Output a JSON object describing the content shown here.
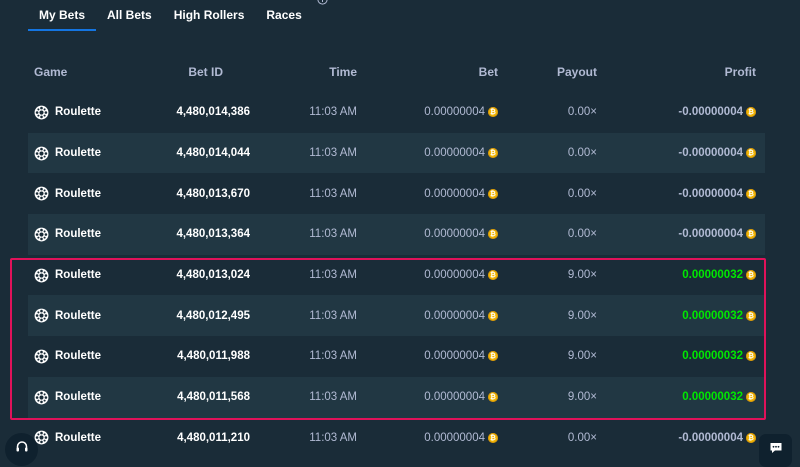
{
  "tabs": [
    {
      "label": "My Bets",
      "active": true
    },
    {
      "label": "All Bets",
      "active": false
    },
    {
      "label": "High Rollers",
      "active": false
    },
    {
      "label": "Races",
      "active": false
    }
  ],
  "columns": {
    "game": "Game",
    "bet_id": "Bet ID",
    "time": "Time",
    "bet": "Bet",
    "payout": "Payout",
    "profit": "Profit"
  },
  "rows": [
    {
      "game": "Roulette",
      "bet_id": "4,480,014,386",
      "time": "11:03 AM",
      "bet": "0.00000004",
      "payout": "0.00×",
      "profit": "-0.00000004",
      "win": false
    },
    {
      "game": "Roulette",
      "bet_id": "4,480,014,044",
      "time": "11:03 AM",
      "bet": "0.00000004",
      "payout": "0.00×",
      "profit": "-0.00000004",
      "win": false
    },
    {
      "game": "Roulette",
      "bet_id": "4,480,013,670",
      "time": "11:03 AM",
      "bet": "0.00000004",
      "payout": "0.00×",
      "profit": "-0.00000004",
      "win": false
    },
    {
      "game": "Roulette",
      "bet_id": "4,480,013,364",
      "time": "11:03 AM",
      "bet": "0.00000004",
      "payout": "0.00×",
      "profit": "-0.00000004",
      "win": false
    },
    {
      "game": "Roulette",
      "bet_id": "4,480,013,024",
      "time": "11:03 AM",
      "bet": "0.00000004",
      "payout": "9.00×",
      "profit": "0.00000032",
      "win": true
    },
    {
      "game": "Roulette",
      "bet_id": "4,480,012,495",
      "time": "11:03 AM",
      "bet": "0.00000004",
      "payout": "9.00×",
      "profit": "0.00000032",
      "win": true
    },
    {
      "game": "Roulette",
      "bet_id": "4,480,011,988",
      "time": "11:03 AM",
      "bet": "0.00000004",
      "payout": "9.00×",
      "profit": "0.00000032",
      "win": true
    },
    {
      "game": "Roulette",
      "bet_id": "4,480,011,568",
      "time": "11:03 AM",
      "bet": "0.00000004",
      "payout": "9.00×",
      "profit": "0.00000032",
      "win": true
    },
    {
      "game": "Roulette",
      "bet_id": "4,480,011,210",
      "time": "11:03 AM",
      "bet": "0.00000004",
      "payout": "0.00×",
      "profit": "-0.00000004",
      "win": false
    }
  ],
  "icons": {
    "game": "roulette-icon",
    "currency": "bitcoin-coin-icon",
    "info": "info-icon",
    "support": "headset-icon",
    "chat": "chat-icon"
  },
  "colors": {
    "background": "#1a2c38",
    "row_alt": "#213743",
    "win": "#00e701",
    "highlight": "#e0125a",
    "tab_active": "#1475e1",
    "coin": "#f2b705"
  }
}
